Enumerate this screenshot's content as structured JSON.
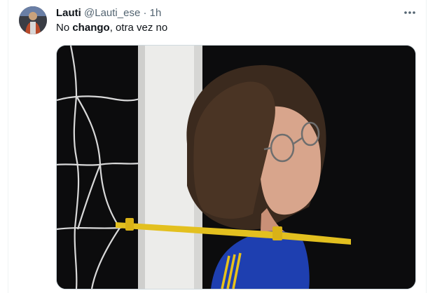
{
  "tweet": {
    "author_name": "Lauti",
    "author_handle": "@Lauti_ese",
    "separator": "·",
    "timestamp": "1h",
    "text_parts": [
      "No ",
      "chango",
      ", otra vez no"
    ],
    "more_icon": "more-horizontal-icon",
    "avatar_icon": "user-avatar"
  },
  "colors": {
    "name": "#0f1419",
    "secondary": "#536471",
    "jersey": "#1e3fb0",
    "jersey_stripe": "#e8c21a",
    "bar": "#e3c01f"
  }
}
